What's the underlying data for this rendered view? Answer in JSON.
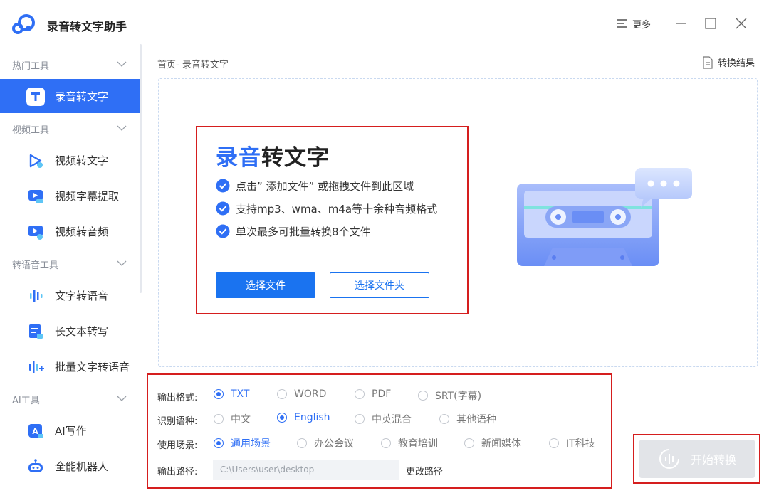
{
  "app": {
    "title": "录音转文字助手",
    "more_label": "更多"
  },
  "colors": {
    "accent": "#2f6ff5",
    "primary_button": "#1a73f0",
    "highlight_border": "#d51e1e",
    "disabled_button": "#e2e4e8"
  },
  "sidebar": {
    "sections": [
      {
        "title": "热门工具",
        "items": [
          {
            "label": "录音转文字",
            "icon": "text-t-icon",
            "active": true
          }
        ]
      },
      {
        "title": "视频工具",
        "items": [
          {
            "label": "视频转文字",
            "icon": "video-to-text-icon"
          },
          {
            "label": "视频字幕提取",
            "icon": "subtitle-extract-icon"
          },
          {
            "label": "视频转音频",
            "icon": "video-to-audio-icon"
          }
        ]
      },
      {
        "title": "转语音工具",
        "items": [
          {
            "label": "文字转语音",
            "icon": "waveform-icon"
          },
          {
            "label": "长文本转写",
            "icon": "long-text-icon"
          },
          {
            "label": "批量文字转语音",
            "icon": "batch-tts-icon"
          }
        ]
      },
      {
        "title": "AI工具",
        "items": [
          {
            "label": "AI写作",
            "icon": "ai-write-icon"
          },
          {
            "label": "全能机器人",
            "icon": "robot-icon"
          }
        ]
      }
    ]
  },
  "main": {
    "breadcrumb": "首页- 录音转文字",
    "result_link": "转换结果",
    "hero": {
      "title_accent": "录音",
      "title_rest": "转文字",
      "features": [
        "点击” 添加文件” 或拖拽文件到此区域",
        "支持mp3、wma、m4a等十余种音频格式",
        "单次最多可批量转换8个文件"
      ],
      "select_file_label": "选择文件",
      "select_folder_label": "选择文件夹"
    }
  },
  "options": {
    "output_format": {
      "label": "输出格式:",
      "choices": [
        "TXT",
        "WORD",
        "PDF",
        "SRT(字幕)"
      ],
      "selected": "TXT"
    },
    "language": {
      "label": "识别语种:",
      "choices": [
        "中文",
        "English",
        "中英混合",
        "其他语种"
      ],
      "selected": "English"
    },
    "scene": {
      "label": "使用场景:",
      "choices": [
        "通用场景",
        "办公会议",
        "教育培训",
        "新闻媒体",
        "IT科技"
      ],
      "selected": "通用场景"
    },
    "output_path": {
      "label": "输出路径:",
      "value": "C:\\Users\\user\\desktop",
      "change_label": "更改路径"
    }
  },
  "start_button": {
    "label": "开始转换",
    "enabled": false
  }
}
